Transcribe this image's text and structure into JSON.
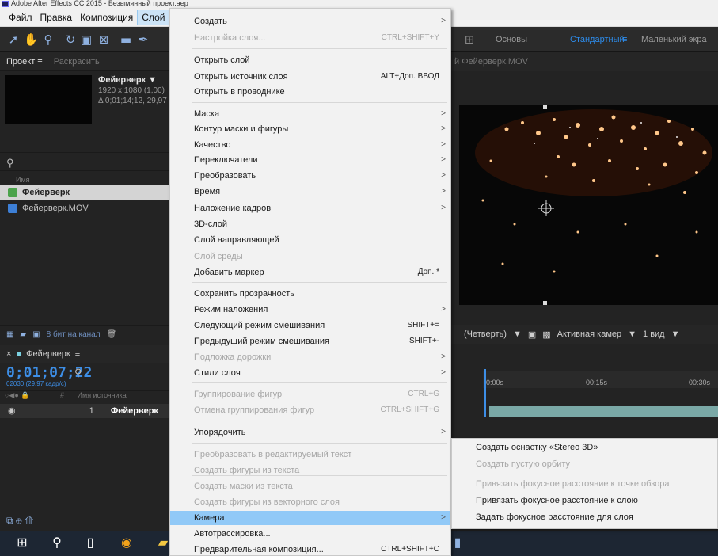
{
  "window": {
    "title": "Adobe After Effects CC 2015 - Безымянный проект.aep"
  },
  "menubar": {
    "items": [
      "Файл",
      "Правка",
      "Композиция",
      "Слой"
    ]
  },
  "workspaces": {
    "basics": "Основы",
    "standard": "Стандартный",
    "small": "Маленький экра"
  },
  "project": {
    "tab_project": "Проект",
    "tab_color": "Раскрасить",
    "comp_name": "Фейерверк ▼",
    "comp_info1": "1920 x 1080 (1,00)",
    "comp_info2": "Δ 0;01;14;12, 29,97",
    "column_name": "Имя",
    "items": [
      "Фейерверк",
      "Фейерверк.MOV"
    ],
    "bpc": "8 бит на канал"
  },
  "viewer": {
    "tab_title": "й Фейерверк.MOV",
    "magnification": "(Четверть)",
    "camera": "Активная камер",
    "views": "1 вид"
  },
  "timeline": {
    "comp_tab": "Фейерверк",
    "timecode": "0;01;07;22",
    "fps": "02030 (29.97 кадр/с)",
    "col_source": "Имя источника",
    "layer_num": "1",
    "layer_name": "Фейерверк",
    "ruler": [
      "0:00s",
      "00:15s",
      "00:30s"
    ]
  },
  "context_menu": {
    "items": [
      {
        "label": "Создать",
        "arrow": ">"
      },
      {
        "label": "Настройка слоя...",
        "shortcut": "CTRL+SHIFT+Y",
        "disabled": true
      },
      {
        "label": "Открыть слой"
      },
      {
        "label": "Открыть источник слоя",
        "shortcut": "ALT+Доп. ВВОД"
      },
      {
        "label": "Открыть в проводнике"
      },
      {
        "label": "Маска",
        "arrow": ">"
      },
      {
        "label": "Контур маски и фигуры",
        "arrow": ">"
      },
      {
        "label": "Качество",
        "arrow": ">"
      },
      {
        "label": "Переключатели",
        "arrow": ">"
      },
      {
        "label": "Преобразовать",
        "arrow": ">"
      },
      {
        "label": "Время",
        "arrow": ">"
      },
      {
        "label": "Наложение кадров",
        "arrow": ">"
      },
      {
        "label": "3D-слой"
      },
      {
        "label": "Слой направляющей"
      },
      {
        "label": "Слой среды",
        "disabled": true
      },
      {
        "label": "Добавить маркер",
        "shortcut": "Доп. *"
      },
      {
        "label": "Сохранить прозрачность"
      },
      {
        "label": "Режим наложения",
        "arrow": ">"
      },
      {
        "label": "Следующий режим смешивания",
        "shortcut": "SHIFT+="
      },
      {
        "label": "Предыдущий режим смешивания",
        "shortcut": "SHIFT+-"
      },
      {
        "label": "Подложка дорожки",
        "arrow": ">",
        "disabled": true
      },
      {
        "label": "Стили слоя",
        "arrow": ">"
      },
      {
        "label": "Группирование фигур",
        "shortcut": "CTRL+G",
        "disabled": true
      },
      {
        "label": "Отмена группирования фигур",
        "shortcut": "CTRL+SHIFT+G",
        "disabled": true
      },
      {
        "label": "Упорядочить",
        "arrow": ">"
      },
      {
        "label": "Преобразовать в редактируемый текст",
        "disabled": true
      },
      {
        "label": "Создать фигуры из текста",
        "disabled": true
      },
      {
        "label": "Создать маски из текста",
        "disabled": true
      },
      {
        "label": "Создать фигуры из векторного слоя",
        "disabled": true
      },
      {
        "label": "Камера",
        "arrow": ">"
      },
      {
        "label": "Автотрассировка..."
      },
      {
        "label": "Предварительная композиция...",
        "shortcut": "CTRL+SHIFT+C"
      }
    ]
  },
  "camera_submenu": {
    "items": [
      {
        "label": "Создать оснастку «Stereo 3D»"
      },
      {
        "label": "Создать пустую орбиту",
        "disabled": true
      },
      {
        "label": "Привязать фокусное расстояние к точке обзора",
        "disabled": true
      },
      {
        "label": "Привязать фокусное расстояние к слою"
      },
      {
        "label": "Задать фокусное расстояние для слоя"
      }
    ]
  }
}
